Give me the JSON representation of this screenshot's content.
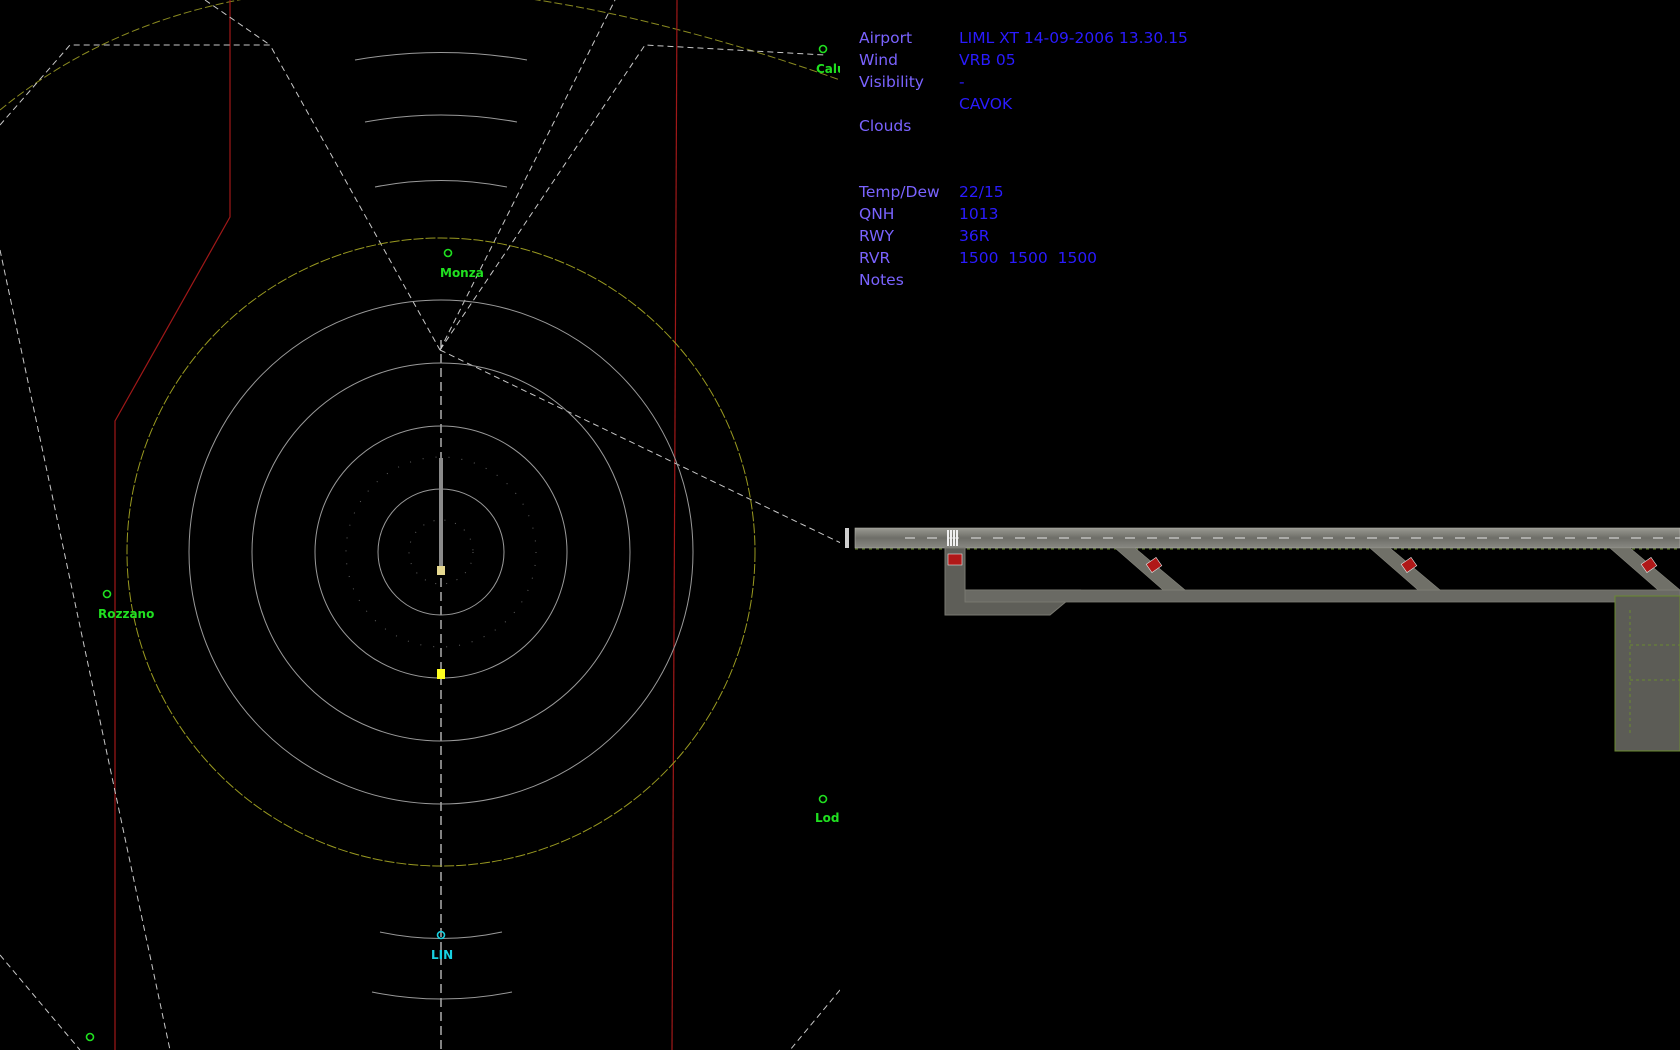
{
  "radar": {
    "fixes": [
      {
        "name": "Calu",
        "color": "#20e020"
      },
      {
        "name": "Monza",
        "color": "#20e020"
      },
      {
        "name": "Rozzano",
        "color": "#20e020"
      },
      {
        "name": "Lodi",
        "color": "#20e020"
      },
      {
        "name": "LIN",
        "color": "#18d0e0"
      },
      {
        "name": "",
        "color": "#20e020"
      }
    ]
  },
  "info": {
    "airport_label": "Airport",
    "airport_value": "LIML XT 14-09-2006 13.30.15",
    "wind_label": "Wind",
    "wind_value": "VRB 05",
    "visibility_label": "Visibility",
    "visibility_value": "-",
    "clouds_value": "CAVOK",
    "clouds_label": "Clouds",
    "temp_label": "Temp/Dew",
    "temp_value": "22/15",
    "qnh_label": "QNH",
    "qnh_value": "1013",
    "rwy_label": "RWY",
    "rwy_value": "36R",
    "rvr_label": "RVR",
    "rvr_value": "1500  1500  1500",
    "notes_label": "Notes"
  },
  "ground": {
    "sign_labels": [
      "",
      "",
      "",
      ""
    ]
  },
  "colors": {
    "label_color": "#7a63ff",
    "value_color": "#2a1bff",
    "background": "#000000"
  }
}
